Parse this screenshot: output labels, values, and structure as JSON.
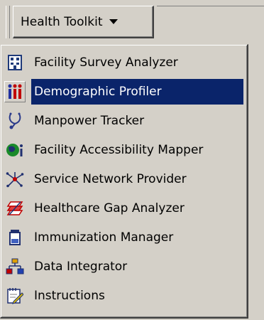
{
  "toolbar": {
    "menu_button_label": "Health Toolkit",
    "menu_button_icon": "dropdown-arrow-icon"
  },
  "menu": {
    "selected_color": "#0a246a",
    "items": [
      {
        "label": "Facility Survey Analyzer",
        "icon": "facility-survey-icon",
        "selected": false
      },
      {
        "label": "Demographic Profiler",
        "icon": "demographic-people-icon",
        "selected": true
      },
      {
        "label": "Manpower Tracker",
        "icon": "stethoscope-icon",
        "selected": false
      },
      {
        "label": "Facility Accessibility Mapper",
        "icon": "globe-info-icon",
        "selected": false
      },
      {
        "label": "Service Network Provider",
        "icon": "network-star-icon",
        "selected": false
      },
      {
        "label": "Healthcare Gap Analyzer",
        "icon": "layers-gap-icon",
        "selected": false
      },
      {
        "label": "Immunization Manager",
        "icon": "vial-icon",
        "selected": false
      },
      {
        "label": "Data Integrator",
        "icon": "hierarchy-icon",
        "selected": false
      },
      {
        "label": "Instructions",
        "icon": "notepad-pencil-icon",
        "selected": false
      }
    ]
  }
}
